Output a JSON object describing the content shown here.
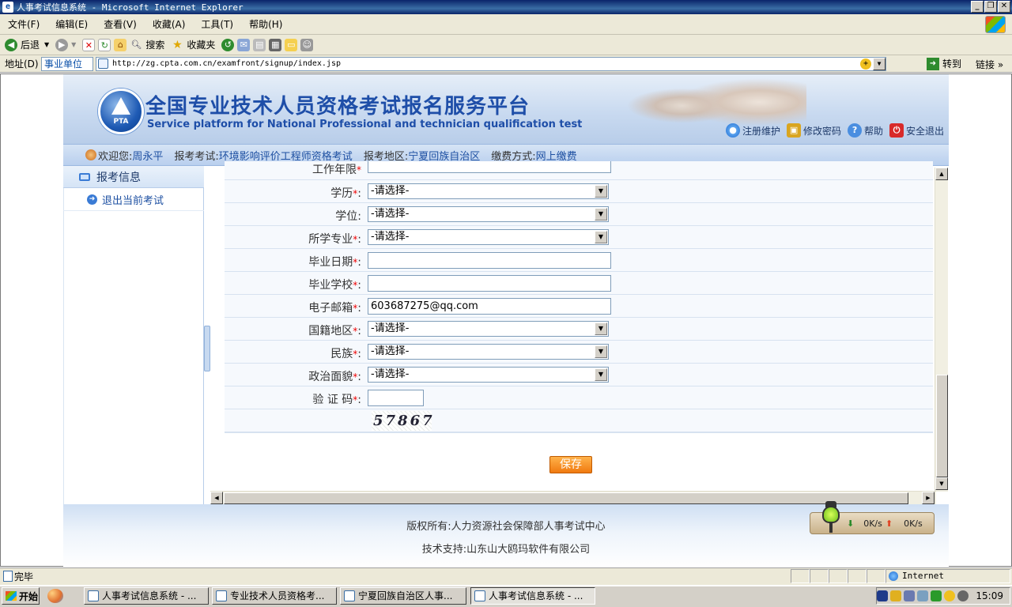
{
  "window": {
    "title": "人事考试信息系统 - Microsoft Internet Explorer"
  },
  "menu": [
    "文件(F)",
    "编辑(E)",
    "查看(V)",
    "收藏(A)",
    "工具(T)",
    "帮助(H)"
  ],
  "toolbar": {
    "back": "后退",
    "search": "搜索",
    "favorites": "收藏夹"
  },
  "address": {
    "label": "地址(D)",
    "select": "事业单位",
    "url": "http://zg.cpta.com.cn/examfront/signup/index.jsp",
    "go": "转到",
    "links": "链接"
  },
  "banner": {
    "logo_text": "PTA",
    "title": "全国专业技术人员资格考试报名服务平台",
    "subtitle": "Service platform for National Professional and technician qualification test",
    "nav": [
      "注册维护",
      "修改密码",
      "帮助",
      "安全退出"
    ]
  },
  "info": {
    "welcome_label": "欢迎您:",
    "user": "周永平",
    "exam_label": "报考考试:",
    "exam": "环境影响评价工程师资格考试",
    "region_label": "报考地区:",
    "region": "宁夏回族自治区",
    "pay_label": "缴费方式:",
    "pay": "网上缴费"
  },
  "sidebar": {
    "header": "报考信息",
    "exit": "退出当前考试"
  },
  "form": {
    "top_cut_label": "工作年限",
    "rows": [
      {
        "label": "学历",
        "required": true,
        "type": "select",
        "value": "-请选择-"
      },
      {
        "label": "学位",
        "required": false,
        "type": "select",
        "value": "-请选择-"
      },
      {
        "label": "所学专业",
        "required": true,
        "type": "select",
        "value": "-请选择-"
      },
      {
        "label": "毕业日期",
        "required": true,
        "type": "input",
        "value": ""
      },
      {
        "label": "毕业学校",
        "required": true,
        "type": "input",
        "value": ""
      },
      {
        "label": "电子邮箱",
        "required": true,
        "type": "input",
        "value": "603687275@qq.com"
      },
      {
        "label": "国籍地区",
        "required": true,
        "type": "select",
        "value": "-请选择-"
      },
      {
        "label": "民族",
        "required": true,
        "type": "select",
        "value": "-请选择-"
      },
      {
        "label": "政治面貌",
        "required": true,
        "type": "select",
        "value": "-请选择-"
      },
      {
        "label": "验 证 码",
        "required": true,
        "type": "captcha",
        "value": ""
      }
    ],
    "required_mark": "*",
    "captcha_text": "57867",
    "save_label": "保存"
  },
  "footer": {
    "copyright": "版权所有:人力资源社会保障部人事考试中心",
    "support": "技术支持:山东山大鸥玛软件有限公司",
    "download_speed": "0K/s",
    "upload_speed": "0K/s"
  },
  "status": {
    "text": "完毕",
    "zone": "Internet"
  },
  "taskbar": {
    "start": "开始",
    "tasks": [
      "人事考试信息系统 - ...",
      "专业技术人员资格考...",
      "宁夏回族自治区人事...",
      "人事考试信息系统 - ..."
    ],
    "clock": "15:09"
  }
}
